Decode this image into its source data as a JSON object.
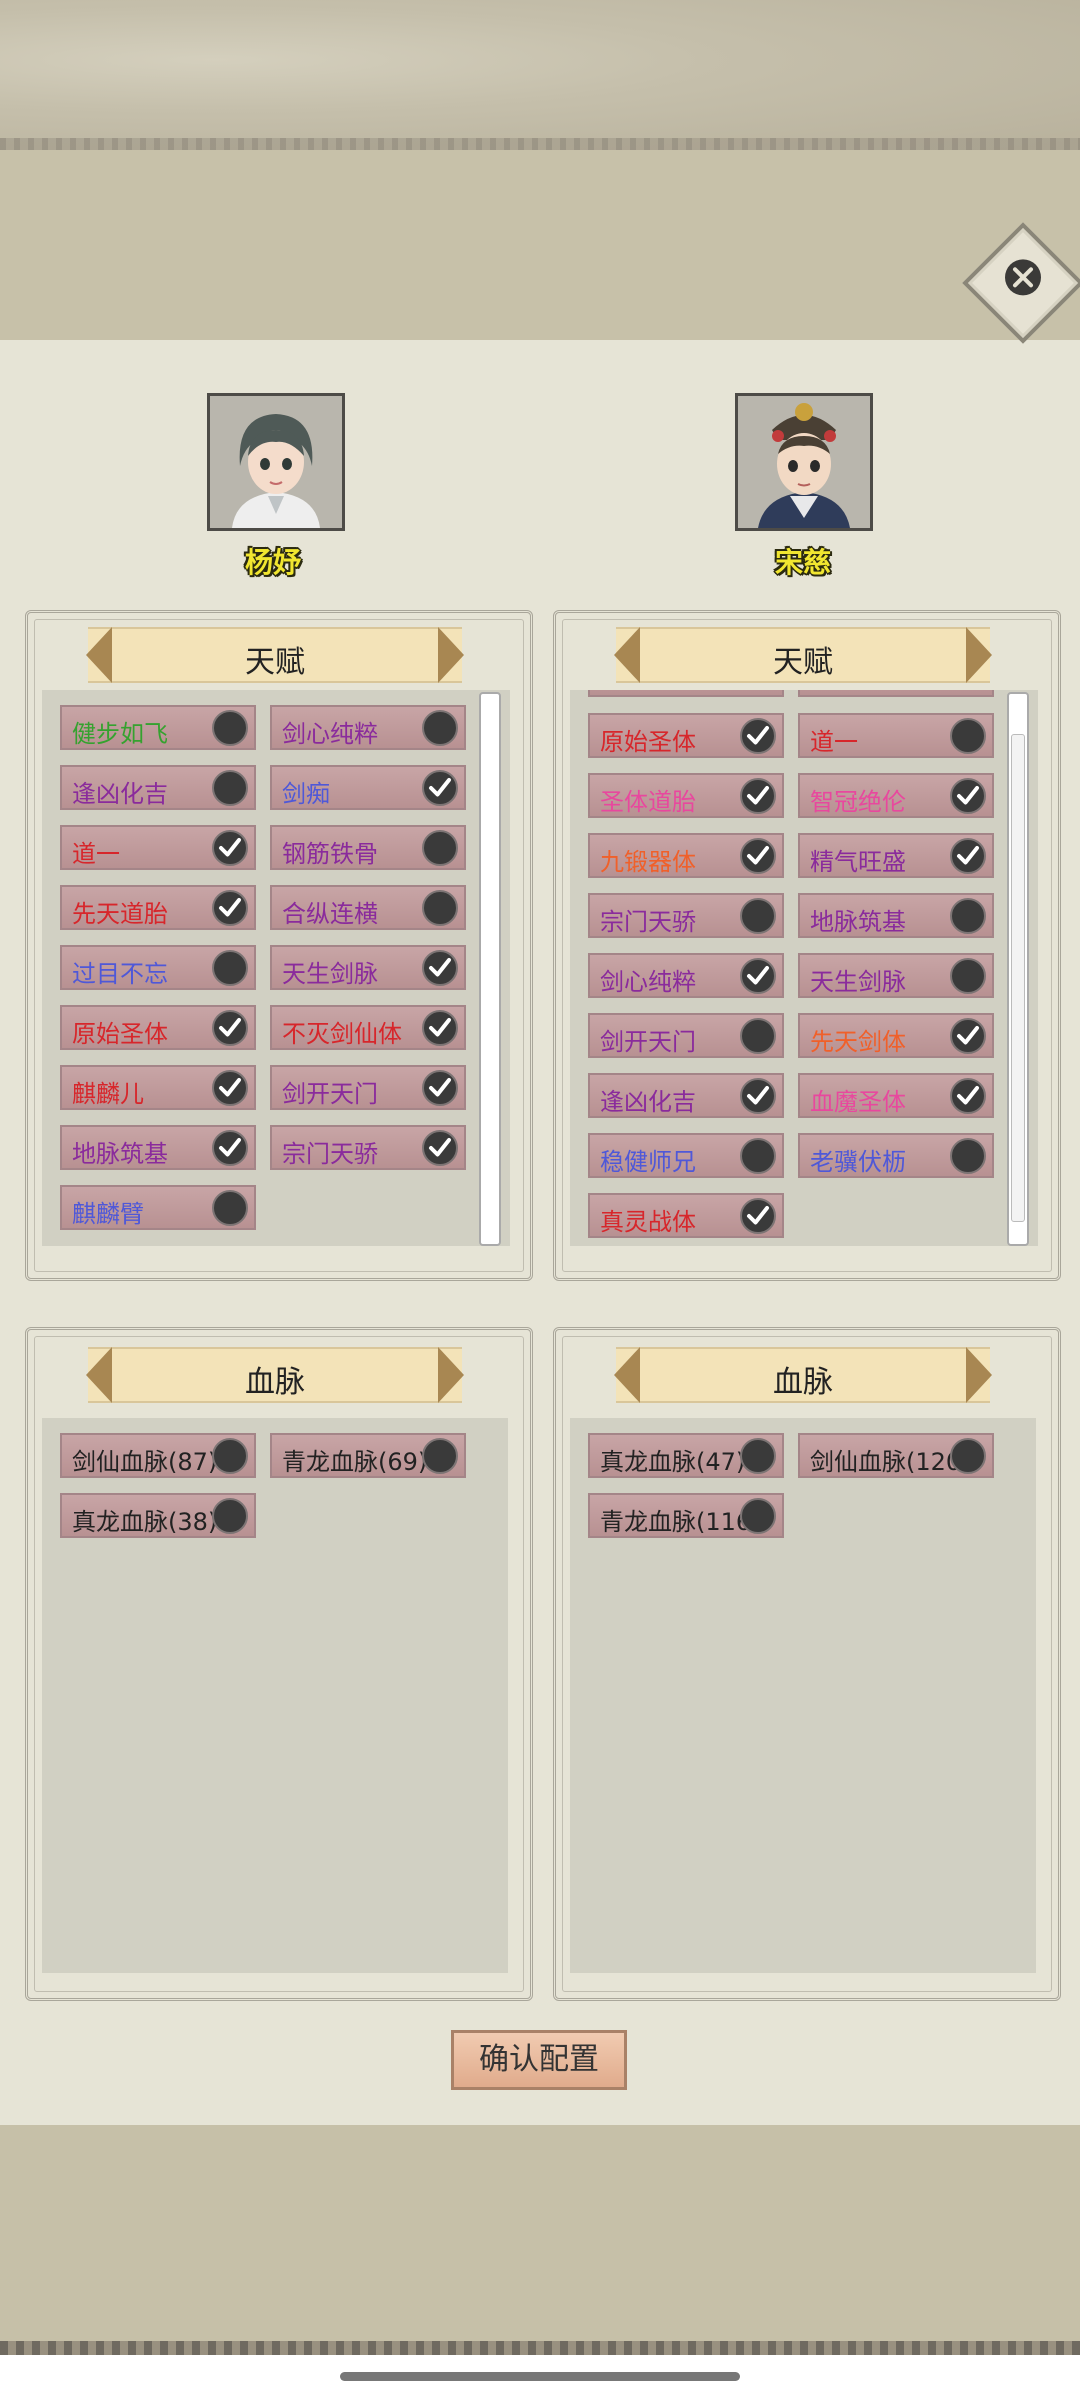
{
  "characters": {
    "left": {
      "name": "杨妤"
    },
    "right": {
      "name": "宋慈"
    }
  },
  "talent_title": "天赋",
  "bloodline_title": "血脉",
  "confirm_label": "确认配置",
  "left_talents": [
    {
      "label": "健步如飞",
      "color": "green",
      "checked": false
    },
    {
      "label": "剑心纯粹",
      "color": "purple",
      "checked": false
    },
    {
      "label": "逢凶化吉",
      "color": "purple",
      "checked": false
    },
    {
      "label": "剑痴",
      "color": "blue",
      "checked": true
    },
    {
      "label": "道一",
      "color": "red",
      "checked": true
    },
    {
      "label": "钢筋铁骨",
      "color": "purple",
      "checked": false
    },
    {
      "label": "先天道胎",
      "color": "red",
      "checked": true
    },
    {
      "label": "合纵连横",
      "color": "purple",
      "checked": false
    },
    {
      "label": "过目不忘",
      "color": "blue",
      "checked": false
    },
    {
      "label": "天生剑脉",
      "color": "purple",
      "checked": true
    },
    {
      "label": "原始圣体",
      "color": "red",
      "checked": true
    },
    {
      "label": "不灭剑仙体",
      "color": "red",
      "checked": true
    },
    {
      "label": "麒麟儿",
      "color": "red",
      "checked": true
    },
    {
      "label": "剑开天门",
      "color": "purple",
      "checked": true
    },
    {
      "label": "地脉筑基",
      "color": "purple",
      "checked": true
    },
    {
      "label": "宗门天骄",
      "color": "purple",
      "checked": true
    },
    {
      "label": "麒麟臂",
      "color": "blue",
      "checked": false
    }
  ],
  "right_talents": [
    {
      "label": "原始圣体",
      "color": "red",
      "checked": true
    },
    {
      "label": "道一",
      "color": "red",
      "checked": false
    },
    {
      "label": "圣体道胎",
      "color": "pink",
      "checked": true
    },
    {
      "label": "智冠绝伦",
      "color": "pink",
      "checked": true
    },
    {
      "label": "九锻器体",
      "color": "orange",
      "checked": true
    },
    {
      "label": "精气旺盛",
      "color": "purple",
      "checked": true
    },
    {
      "label": "宗门天骄",
      "color": "purple",
      "checked": false
    },
    {
      "label": "地脉筑基",
      "color": "purple",
      "checked": false
    },
    {
      "label": "剑心纯粹",
      "color": "purple",
      "checked": true
    },
    {
      "label": "天生剑脉",
      "color": "purple",
      "checked": false
    },
    {
      "label": "剑开天门",
      "color": "purple",
      "checked": false
    },
    {
      "label": "先天剑体",
      "color": "orange",
      "checked": true
    },
    {
      "label": "逢凶化吉",
      "color": "purple",
      "checked": true
    },
    {
      "label": "血魔圣体",
      "color": "pink",
      "checked": true
    },
    {
      "label": "稳健师兄",
      "color": "blue",
      "checked": false
    },
    {
      "label": "老骥伏枥",
      "color": "blue",
      "checked": false
    },
    {
      "label": "真灵战体",
      "color": "red",
      "checked": true
    }
  ],
  "left_bloodlines": [
    {
      "label": "剑仙血脉(87)",
      "checked": false
    },
    {
      "label": "青龙血脉(69)",
      "checked": false
    },
    {
      "label": "真龙血脉(38)",
      "checked": false
    }
  ],
  "right_bloodlines": [
    {
      "label": "真龙血脉(47)",
      "checked": false
    },
    {
      "label": "剑仙血脉(120)",
      "checked": false
    },
    {
      "label": "青龙血脉(116)",
      "checked": false
    }
  ],
  "colors": {
    "green": "#35a22f",
    "purple": "#8a2b9c",
    "blue": "#4f58d8",
    "red": "#d7262b",
    "orange": "#f0602a",
    "pink": "#e8489e"
  }
}
